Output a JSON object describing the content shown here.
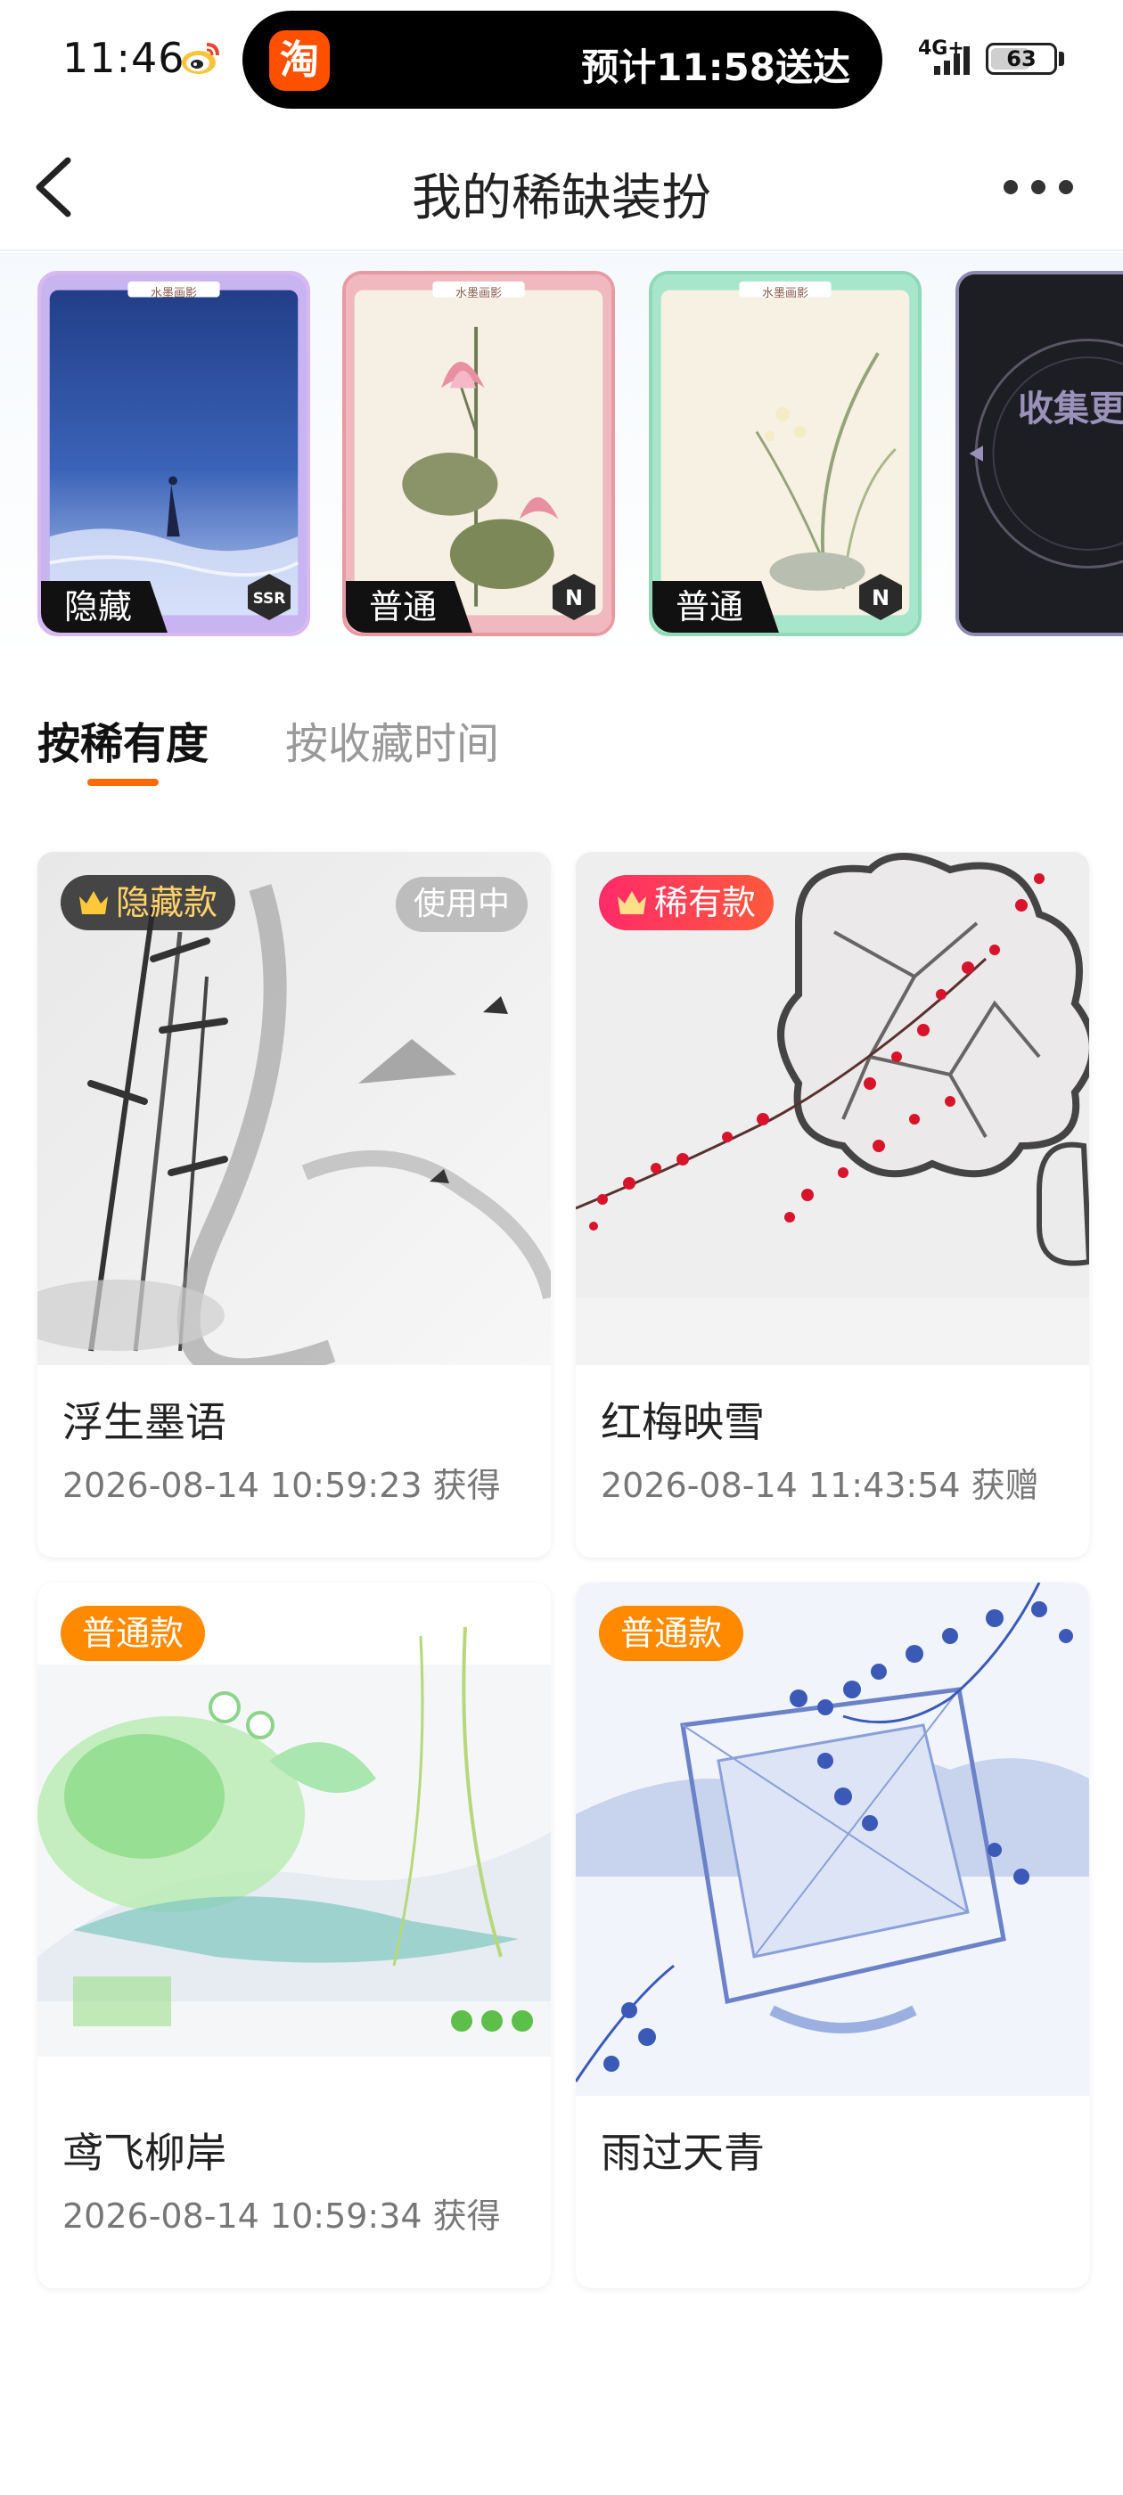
{
  "status_bar": {
    "time": "11:46",
    "island_app_glyph": "淘",
    "island_text": "预计11:58送达",
    "network": "4G+",
    "battery": "63",
    "battery_level": 0.63
  },
  "nav": {
    "title": "我的稀缺装扮",
    "back_icon": "chevron-left-icon",
    "more_icon": "more-dots-icon"
  },
  "frames": [
    {
      "tag": "隐藏",
      "badge": "SSR",
      "theme": "sea-night",
      "header_label": "水墨画影"
    },
    {
      "tag": "普通",
      "badge": "N",
      "theme": "lotus",
      "header_label": "水墨画影"
    },
    {
      "tag": "普通",
      "badge": "N",
      "theme": "orchid",
      "header_label": "水墨画影"
    }
  ],
  "collect_more": "收集更",
  "tabs": {
    "active": "按稀有度",
    "inactive": "按收藏时间"
  },
  "cards": [
    {
      "rarity": "隐藏款",
      "status": "使用中",
      "title": "浮生墨语",
      "meta": "2026-08-14 10:59:23 获得"
    },
    {
      "rarity": "稀有款",
      "title": "红梅映雪",
      "meta": "2026-08-14 11:43:54 获赠"
    },
    {
      "rarity": "普通款",
      "title": "鸢飞柳岸",
      "meta": "2026-08-14 10:59:34 获得"
    },
    {
      "rarity": "普通款",
      "title": "雨过天青",
      "meta": ""
    }
  ],
  "colors": {
    "accent": "#ff6a00",
    "rarity_hidden_text": "#ffd36a",
    "rarity_rare": "#ff2a6a",
    "rarity_normal": "#ff8a00"
  }
}
